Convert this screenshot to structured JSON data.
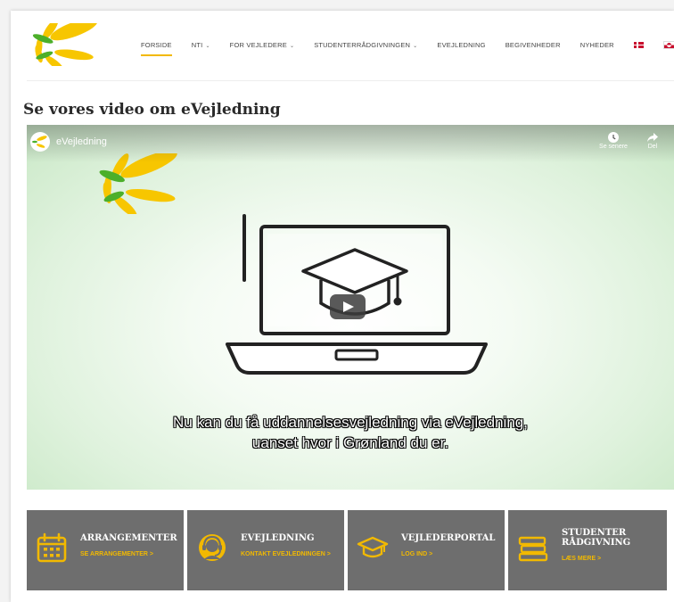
{
  "nav": {
    "items": [
      {
        "label": "FORSIDE",
        "dropdown": false
      },
      {
        "label": "NTI",
        "dropdown": true
      },
      {
        "label": "FOR VEJLEDERE",
        "dropdown": true
      },
      {
        "label": "STUDENTERRÅDGIVNINGEN",
        "dropdown": true
      },
      {
        "label": "EVEJLEDNING",
        "dropdown": false
      },
      {
        "label": "BEGIVENHEDER",
        "dropdown": false
      },
      {
        "label": "NYHEDER",
        "dropdown": false
      }
    ],
    "caret": "⌄"
  },
  "section_title": "Se vores video om eVejledning",
  "video": {
    "title": "eVejledning",
    "watch_later": "Se senere",
    "share": "Del",
    "subtitle_line1": "Nu kan du få uddannelsesvejledning via eVejledning,",
    "subtitle_line2": "uanset hvor i Grønland du er."
  },
  "tiles": [
    {
      "title": "ARRANGEMENTER",
      "link": "SE ARRANGEMENTER >"
    },
    {
      "title": "EVEJLEDNING",
      "link": "KONTAKT EVEJLEDNINGEN >"
    },
    {
      "title": "VEJLEDERPORTAL",
      "link": "LOG IND >"
    },
    {
      "title_line1": "STUDENTER",
      "title_line2": "RÅDGIVNING",
      "link": "LÆS MERE >"
    }
  ],
  "colors": {
    "accent": "#f2b900",
    "tile_bg": "#6e6e6e",
    "logo_yellow": "#f7c600",
    "logo_green": "#4caf2a"
  }
}
